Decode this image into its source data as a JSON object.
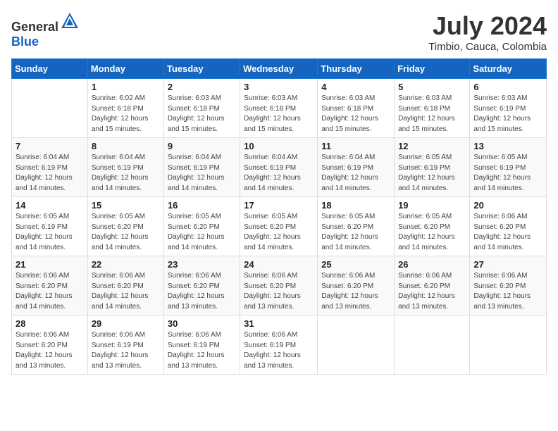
{
  "header": {
    "logo_general": "General",
    "logo_blue": "Blue",
    "month_year": "July 2024",
    "location": "Timbio, Cauca, Colombia"
  },
  "weekdays": [
    "Sunday",
    "Monday",
    "Tuesday",
    "Wednesday",
    "Thursday",
    "Friday",
    "Saturday"
  ],
  "weeks": [
    [
      {
        "day": null
      },
      {
        "day": "1",
        "sunrise": "6:02 AM",
        "sunset": "6:18 PM",
        "daylight": "12 hours and 15 minutes."
      },
      {
        "day": "2",
        "sunrise": "6:03 AM",
        "sunset": "6:18 PM",
        "daylight": "12 hours and 15 minutes."
      },
      {
        "day": "3",
        "sunrise": "6:03 AM",
        "sunset": "6:18 PM",
        "daylight": "12 hours and 15 minutes."
      },
      {
        "day": "4",
        "sunrise": "6:03 AM",
        "sunset": "6:18 PM",
        "daylight": "12 hours and 15 minutes."
      },
      {
        "day": "5",
        "sunrise": "6:03 AM",
        "sunset": "6:18 PM",
        "daylight": "12 hours and 15 minutes."
      },
      {
        "day": "6",
        "sunrise": "6:03 AM",
        "sunset": "6:19 PM",
        "daylight": "12 hours and 15 minutes."
      }
    ],
    [
      {
        "day": "7",
        "sunrise": "6:04 AM",
        "sunset": "6:19 PM",
        "daylight": "12 hours and 14 minutes."
      },
      {
        "day": "8",
        "sunrise": "6:04 AM",
        "sunset": "6:19 PM",
        "daylight": "12 hours and 14 minutes."
      },
      {
        "day": "9",
        "sunrise": "6:04 AM",
        "sunset": "6:19 PM",
        "daylight": "12 hours and 14 minutes."
      },
      {
        "day": "10",
        "sunrise": "6:04 AM",
        "sunset": "6:19 PM",
        "daylight": "12 hours and 14 minutes."
      },
      {
        "day": "11",
        "sunrise": "6:04 AM",
        "sunset": "6:19 PM",
        "daylight": "12 hours and 14 minutes."
      },
      {
        "day": "12",
        "sunrise": "6:05 AM",
        "sunset": "6:19 PM",
        "daylight": "12 hours and 14 minutes."
      },
      {
        "day": "13",
        "sunrise": "6:05 AM",
        "sunset": "6:19 PM",
        "daylight": "12 hours and 14 minutes."
      }
    ],
    [
      {
        "day": "14",
        "sunrise": "6:05 AM",
        "sunset": "6:19 PM",
        "daylight": "12 hours and 14 minutes."
      },
      {
        "day": "15",
        "sunrise": "6:05 AM",
        "sunset": "6:20 PM",
        "daylight": "12 hours and 14 minutes."
      },
      {
        "day": "16",
        "sunrise": "6:05 AM",
        "sunset": "6:20 PM",
        "daylight": "12 hours and 14 minutes."
      },
      {
        "day": "17",
        "sunrise": "6:05 AM",
        "sunset": "6:20 PM",
        "daylight": "12 hours and 14 minutes."
      },
      {
        "day": "18",
        "sunrise": "6:05 AM",
        "sunset": "6:20 PM",
        "daylight": "12 hours and 14 minutes."
      },
      {
        "day": "19",
        "sunrise": "6:05 AM",
        "sunset": "6:20 PM",
        "daylight": "12 hours and 14 minutes."
      },
      {
        "day": "20",
        "sunrise": "6:06 AM",
        "sunset": "6:20 PM",
        "daylight": "12 hours and 14 minutes."
      }
    ],
    [
      {
        "day": "21",
        "sunrise": "6:06 AM",
        "sunset": "6:20 PM",
        "daylight": "12 hours and 14 minutes."
      },
      {
        "day": "22",
        "sunrise": "6:06 AM",
        "sunset": "6:20 PM",
        "daylight": "12 hours and 14 minutes."
      },
      {
        "day": "23",
        "sunrise": "6:06 AM",
        "sunset": "6:20 PM",
        "daylight": "12 hours and 13 minutes."
      },
      {
        "day": "24",
        "sunrise": "6:06 AM",
        "sunset": "6:20 PM",
        "daylight": "12 hours and 13 minutes."
      },
      {
        "day": "25",
        "sunrise": "6:06 AM",
        "sunset": "6:20 PM",
        "daylight": "12 hours and 13 minutes."
      },
      {
        "day": "26",
        "sunrise": "6:06 AM",
        "sunset": "6:20 PM",
        "daylight": "12 hours and 13 minutes."
      },
      {
        "day": "27",
        "sunrise": "6:06 AM",
        "sunset": "6:20 PM",
        "daylight": "12 hours and 13 minutes."
      }
    ],
    [
      {
        "day": "28",
        "sunrise": "6:06 AM",
        "sunset": "6:20 PM",
        "daylight": "12 hours and 13 minutes."
      },
      {
        "day": "29",
        "sunrise": "6:06 AM",
        "sunset": "6:19 PM",
        "daylight": "12 hours and 13 minutes."
      },
      {
        "day": "30",
        "sunrise": "6:06 AM",
        "sunset": "6:19 PM",
        "daylight": "12 hours and 13 minutes."
      },
      {
        "day": "31",
        "sunrise": "6:06 AM",
        "sunset": "6:19 PM",
        "daylight": "12 hours and 13 minutes."
      },
      {
        "day": null
      },
      {
        "day": null
      },
      {
        "day": null
      }
    ]
  ],
  "labels": {
    "sunrise": "Sunrise:",
    "sunset": "Sunset:",
    "daylight": "Daylight:"
  }
}
